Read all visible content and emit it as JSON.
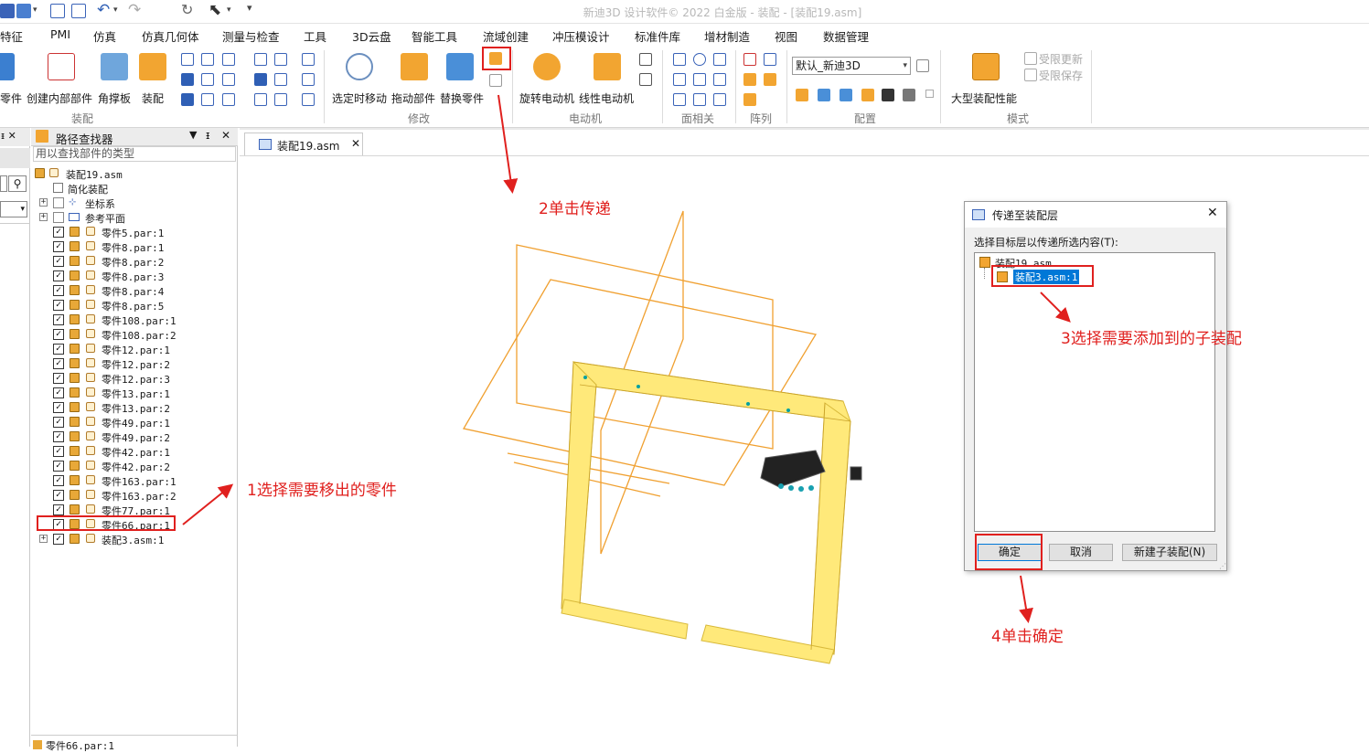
{
  "window": {
    "title": "新迪3D 设计软件© 2022 白金版 - 装配 - [装配19.asm]"
  },
  "menu": [
    "特征",
    "PMI",
    "仿真",
    "仿真几何体",
    "测量与检查",
    "工具",
    "3D云盘",
    "智能工具",
    "流域创建",
    "冲压模设计",
    "标准件库",
    "增材制造",
    "视图",
    "数据管理"
  ],
  "ribbon": {
    "buttons": [
      "零件",
      "创建内部部件",
      "角撑板",
      "装配",
      "选定时移动",
      "拖动部件",
      "替换零件",
      "旋转电动机",
      "线性电动机",
      "大型装配性能"
    ],
    "groups": [
      "装配",
      "修改",
      "电动机",
      "面相关",
      "阵列",
      "配置",
      "模式"
    ],
    "config_select": "默认_新迪3D",
    "disabled": [
      "受限更新",
      "受限保存"
    ]
  },
  "pathfinder": {
    "title": "路径查找器",
    "search_placeholder": "用以查找部件的类型",
    "root": "装配19.asm",
    "simplified": "简化装配",
    "coord": "坐标系",
    "refplane": "参考平面",
    "items": [
      "零件5.par:1",
      "零件8.par:1",
      "零件8.par:2",
      "零件8.par:3",
      "零件8.par:4",
      "零件8.par:5",
      "零件108.par:1",
      "零件108.par:2",
      "零件12.par:1",
      "零件12.par:2",
      "零件12.par:3",
      "零件13.par:1",
      "零件13.par:2",
      "零件49.par:1",
      "零件49.par:2",
      "零件42.par:1",
      "零件42.par:2",
      "零件163.par:1",
      "零件163.par:2",
      "零件77.par:1",
      "零件66.par:1"
    ],
    "subasm": "装配3.asm:1",
    "bottom_item": "零件66.par:1"
  },
  "document_tab": "装配19.asm",
  "dialog": {
    "title": "传递至装配层",
    "prompt": "选择目标层以传递所选内容(T):",
    "root": "装配19.asm",
    "selected": "装配3.asm:1",
    "ok": "确定",
    "cancel": "取消",
    "new_sub": "新建子装配(N)"
  },
  "annotations": {
    "a1": "1选择需要移出的零件",
    "a2": "2单击传递",
    "a3": "3选择需要添加到的子装配",
    "a4": "4单击确定"
  },
  "colors": {
    "accent": "#e0201e",
    "model": "#ffe97a",
    "wire": "#f0a030"
  }
}
